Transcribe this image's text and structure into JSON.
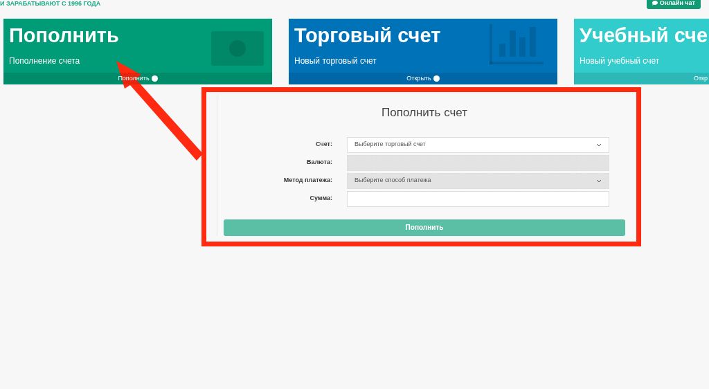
{
  "header": {
    "tagline": "И ЗАРАБАТЫВАЮТ С 1996 ГОДА",
    "chat_button": "Онлайн чат"
  },
  "cards": [
    {
      "title": "Пополнить",
      "subtitle": "Пополнение счета",
      "link": "Пополнить",
      "color": "#009b77"
    },
    {
      "title": "Торговый счет",
      "subtitle": "Новый торговый счет",
      "link": "Открыть",
      "color": "#0072b8"
    },
    {
      "title": "Учебный сче",
      "subtitle": "Новый учебный счет",
      "link": "Откр",
      "color": "#33cccc"
    }
  ],
  "form": {
    "title": "Пополнить счет",
    "fields": [
      {
        "label": "Счет:",
        "kind": "select",
        "placeholder": "Выберите торговый счет",
        "disabled": false
      },
      {
        "label": "Валюта:",
        "kind": "input",
        "disabled": true
      },
      {
        "label": "Метод платежа:",
        "kind": "select",
        "placeholder": "Выберите способ платежа",
        "disabled": true
      },
      {
        "label": "Сумма:",
        "kind": "input",
        "disabled": false
      }
    ],
    "submit": "Пополнить"
  }
}
